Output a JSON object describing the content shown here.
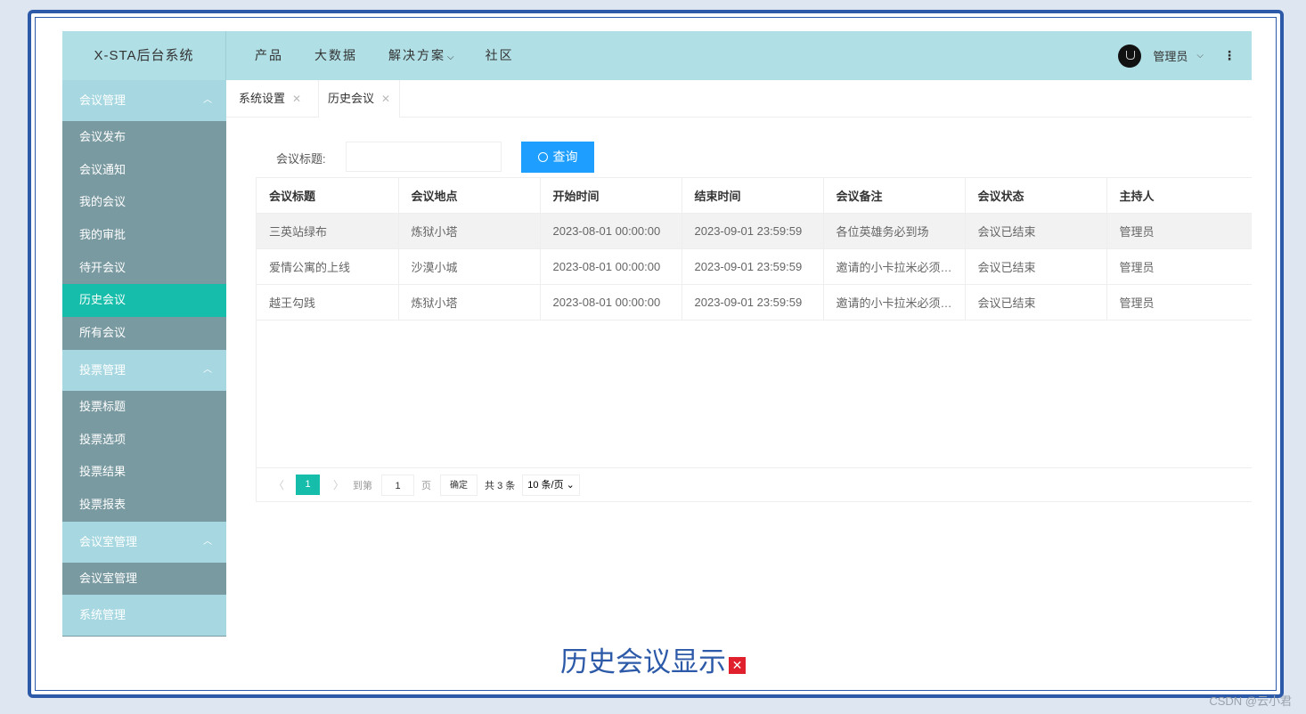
{
  "header": {
    "logo": "X-STA后台系统",
    "nav": [
      {
        "label": "产品",
        "chevron": false
      },
      {
        "label": "大数据",
        "chevron": false
      },
      {
        "label": "解决方案",
        "chevron": true
      },
      {
        "label": "社区",
        "chevron": false
      }
    ],
    "user": "管理员",
    "chevron": "⌵",
    "more": "⋮"
  },
  "sidebar": {
    "groups": [
      {
        "title": "会议管理",
        "items": [
          "会议发布",
          "会议通知",
          "我的会议",
          "我的审批",
          "待开会议",
          "历史会议",
          "所有会议"
        ]
      },
      {
        "title": "投票管理",
        "items": [
          "投票标题",
          "投票选项",
          "投票结果",
          "投票报表"
        ]
      },
      {
        "title": "会议室管理",
        "items": [
          "会议室管理"
        ]
      },
      {
        "title": "系统管理",
        "items": []
      }
    ],
    "active": "历史会议",
    "arrow": "︿"
  },
  "tabs": [
    {
      "label": "系统设置",
      "close": "✕"
    },
    {
      "label": "历史会议",
      "close": "✕"
    }
  ],
  "search": {
    "label": "会议标题:",
    "value": "",
    "button": "查询",
    "button_icon": "search-icon"
  },
  "table": {
    "columns": [
      "会议标题",
      "会议地点",
      "开始时间",
      "结束时间",
      "会议备注",
      "会议状态",
      "主持人"
    ],
    "rows": [
      [
        "三英站绿布",
        "炼狱小塔",
        "2023-08-01 00:00:00",
        "2023-09-01 23:59:59",
        "各位英雄务必到场",
        "会议已结束",
        "管理员"
      ],
      [
        "爱情公寓的上线",
        "沙漠小城",
        "2023-08-01 00:00:00",
        "2023-09-01 23:59:59",
        "邀请的小卡拉米必须…",
        "会议已结束",
        "管理员"
      ],
      [
        "越王勾践",
        "炼狱小塔",
        "2023-08-01 00:00:00",
        "2023-09-01 23:59:59",
        "邀请的小卡拉米必须…",
        "会议已结束",
        "管理员"
      ]
    ]
  },
  "pager": {
    "prev": "〈",
    "current": "1",
    "next": "〉",
    "goto": "到第",
    "input": "1",
    "page": "页",
    "ok": "确定",
    "total": "共 3 条",
    "size": "10 条/页 ⌄"
  },
  "caption": {
    "text": "历史会议显示",
    "mark": "✕"
  },
  "watermark": "CSDN @云小君",
  "colors": {
    "header": "#b0dfe5",
    "sidebar": "#7a9aa1",
    "active": "#16bdaa",
    "button": "#1e9fff",
    "frame": "#2d5aa8"
  }
}
